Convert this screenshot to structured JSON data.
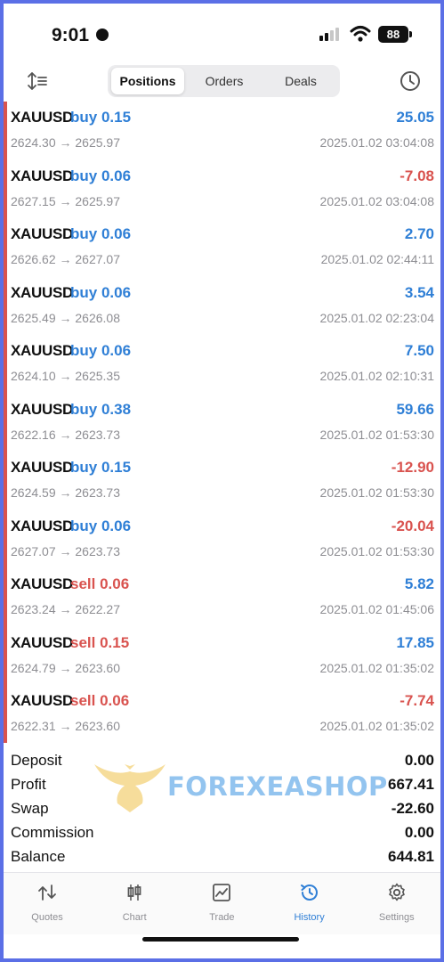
{
  "status": {
    "time": "9:01",
    "battery": "88"
  },
  "segments": [
    "Positions",
    "Orders",
    "Deals"
  ],
  "deals": [
    {
      "symbol": "XAUUSD",
      "side": "buy",
      "volume": "0.15",
      "profit": "25.05",
      "open": "2624.30",
      "close": "2625.97",
      "time": "2025.01.02 03:04:08"
    },
    {
      "symbol": "XAUUSD",
      "side": "buy",
      "volume": "0.06",
      "profit": "-7.08",
      "open": "2627.15",
      "close": "2625.97",
      "time": "2025.01.02 03:04:08"
    },
    {
      "symbol": "XAUUSD",
      "side": "buy",
      "volume": "0.06",
      "profit": "2.70",
      "open": "2626.62",
      "close": "2627.07",
      "time": "2025.01.02 02:44:11"
    },
    {
      "symbol": "XAUUSD",
      "side": "buy",
      "volume": "0.06",
      "profit": "3.54",
      "open": "2625.49",
      "close": "2626.08",
      "time": "2025.01.02 02:23:04"
    },
    {
      "symbol": "XAUUSD",
      "side": "buy",
      "volume": "0.06",
      "profit": "7.50",
      "open": "2624.10",
      "close": "2625.35",
      "time": "2025.01.02 02:10:31"
    },
    {
      "symbol": "XAUUSD",
      "side": "buy",
      "volume": "0.38",
      "profit": "59.66",
      "open": "2622.16",
      "close": "2623.73",
      "time": "2025.01.02 01:53:30"
    },
    {
      "symbol": "XAUUSD",
      "side": "buy",
      "volume": "0.15",
      "profit": "-12.90",
      "open": "2624.59",
      "close": "2623.73",
      "time": "2025.01.02 01:53:30"
    },
    {
      "symbol": "XAUUSD",
      "side": "buy",
      "volume": "0.06",
      "profit": "-20.04",
      "open": "2627.07",
      "close": "2623.73",
      "time": "2025.01.02 01:53:30"
    },
    {
      "symbol": "XAUUSD",
      "side": "sell",
      "volume": "0.06",
      "profit": "5.82",
      "open": "2623.24",
      "close": "2622.27",
      "time": "2025.01.02 01:45:06"
    },
    {
      "symbol": "XAUUSD",
      "side": "sell",
      "volume": "0.15",
      "profit": "17.85",
      "open": "2624.79",
      "close": "2623.60",
      "time": "2025.01.02 01:35:02"
    },
    {
      "symbol": "XAUUSD",
      "side": "sell",
      "volume": "0.06",
      "profit": "-7.74",
      "open": "2622.31",
      "close": "2623.60",
      "time": "2025.01.02 01:35:02"
    }
  ],
  "summary": [
    {
      "label": "Deposit",
      "value": "0.00"
    },
    {
      "label": "Profit",
      "value": "667.41"
    },
    {
      "label": "Swap",
      "value": "-22.60"
    },
    {
      "label": "Commission",
      "value": "0.00"
    },
    {
      "label": "Balance",
      "value": "644.81"
    }
  ],
  "watermark": "FOREXEASHOP",
  "tabs": [
    {
      "label": "Quotes",
      "icon": "quotes-icon"
    },
    {
      "label": "Chart",
      "icon": "chart-icon"
    },
    {
      "label": "Trade",
      "icon": "trade-icon"
    },
    {
      "label": "History",
      "icon": "history-icon"
    },
    {
      "label": "Settings",
      "icon": "settings-icon"
    }
  ],
  "colors": {
    "buy": "#2f7fd6",
    "sell": "#d9534f",
    "positive": "#2f7fd6",
    "negative": "#d9534f",
    "accent_bar": "#d9534f",
    "page_border": "#5b6fe6"
  }
}
